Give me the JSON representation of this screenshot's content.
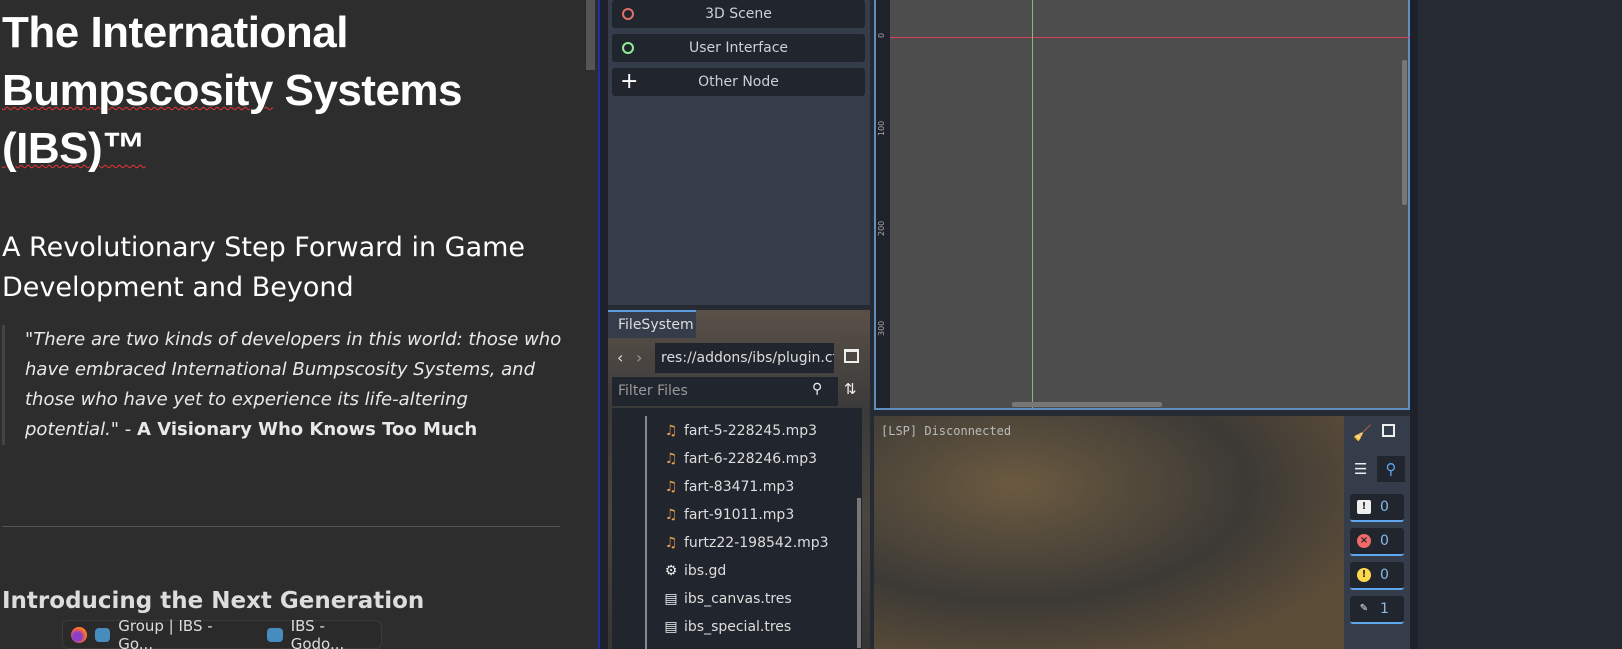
{
  "article": {
    "title_l1": "The International",
    "title_l2a": "Bumpscosity",
    " title_l2b": "",
    "title_l2b": " Systems",
    "title_l3": "(IBS)™",
    "subtitle": "A Revolutionary Step Forward in Game Development and Beyond",
    "quote": "\"There are two kinds of developers in this world: those who have embraced International Bumpscosity Systems, and those who have yet to experience its life-altering potential.\"",
    "quote_sep": " - ",
    "quote_author": "A Visionary Who Knows Too Much",
    "section_heading": "Introducing the Next Generation"
  },
  "taskbar": {
    "items": [
      {
        "label": "Group | IBS - Go..."
      },
      {
        "label": "IBS - Godo..."
      }
    ]
  },
  "scene_dock": {
    "buttons": [
      {
        "label": "3D Scene",
        "color": "#e0706a"
      },
      {
        "label": "User Interface",
        "color": "#8eef97"
      },
      {
        "label": "Other Node"
      }
    ]
  },
  "filesystem": {
    "tab": "FileSystem",
    "path": "res://addons/ibs/plugin.cf",
    "filter_placeholder": "Filter Files",
    "files": [
      {
        "name": "fart-5-228245.mp3"
      },
      {
        "name": "fart-6-228246.mp3"
      },
      {
        "name": "fart-83471.mp3"
      },
      {
        "name": "fart-91011.mp3"
      },
      {
        "name": "furtz22-198542.mp3"
      },
      {
        "name": "ibs.gd"
      },
      {
        "name": "ibs_canvas.tres"
      },
      {
        "name": "ibs_special.tres"
      }
    ]
  },
  "viewport": {
    "ruler": [
      "0",
      "100",
      "200",
      "300"
    ]
  },
  "output": {
    "text": "[LSP] Disconnected",
    "counts": {
      "messages": "0",
      "errors": "0",
      "warnings": "0",
      "editor": "1"
    }
  }
}
